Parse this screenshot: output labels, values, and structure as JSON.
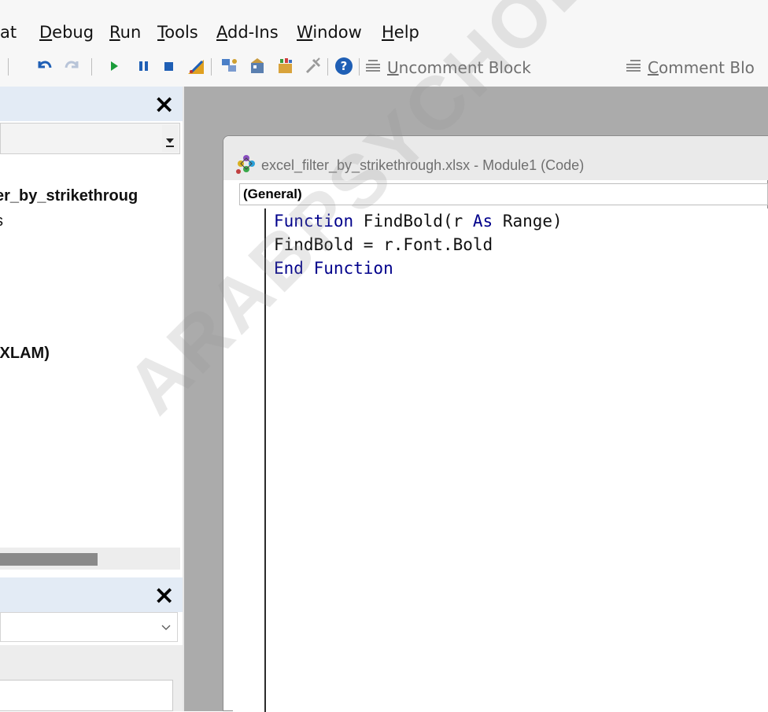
{
  "menu": {
    "items": [
      {
        "pre": "at",
        "acc": "",
        "post": ""
      },
      {
        "pre": "",
        "acc": "D",
        "post": "ebug"
      },
      {
        "pre": "",
        "acc": "R",
        "post": "un"
      },
      {
        "pre": "",
        "acc": "T",
        "post": "ools"
      },
      {
        "pre": "",
        "acc": "A",
        "post": "dd-Ins"
      },
      {
        "pre": "",
        "acc": "W",
        "post": "indow"
      },
      {
        "pre": "",
        "acc": "H",
        "post": "elp"
      }
    ]
  },
  "toolbar": {
    "uncomment_acc": "U",
    "uncomment_rest": "ncomment Block",
    "comment_acc": "C",
    "comment_rest": "omment Blo",
    "icons": [
      "undo-icon",
      "redo-icon",
      "run-icon",
      "break-icon",
      "reset-icon",
      "design-mode-icon",
      "project-explorer-icon",
      "properties-icon",
      "object-browser-icon",
      "toolbox-icon",
      "help-icon",
      "uncomment-block-icon",
      "comment-block-icon"
    ]
  },
  "project_panel": {
    "close": "×",
    "tree": [
      ")",
      "er_by_strikethroug",
      "s",
      ".XLAM)"
    ]
  },
  "properties_panel": {
    "close": "×"
  },
  "code_window": {
    "title": "excel_filter_by_strikethrough.xlsx - Module1 (Code)",
    "object_combo": "(General)",
    "lines": [
      [
        {
          "t": "Function",
          "kw": true
        },
        {
          "t": " FindBold(r ",
          "kw": false
        },
        {
          "t": "As",
          "kw": true
        },
        {
          "t": " Range)",
          "kw": false
        }
      ],
      [
        {
          "t": "FindBold = r.Font.Bold",
          "kw": false
        }
      ],
      [
        {
          "t": "End Function",
          "kw": true
        }
      ]
    ]
  },
  "watermark": "ARABPSYCHOLOGY",
  "colors": {
    "keyword": "#00008b",
    "mdi_background": "#ababab",
    "panel_title": "#e3ebf5"
  }
}
